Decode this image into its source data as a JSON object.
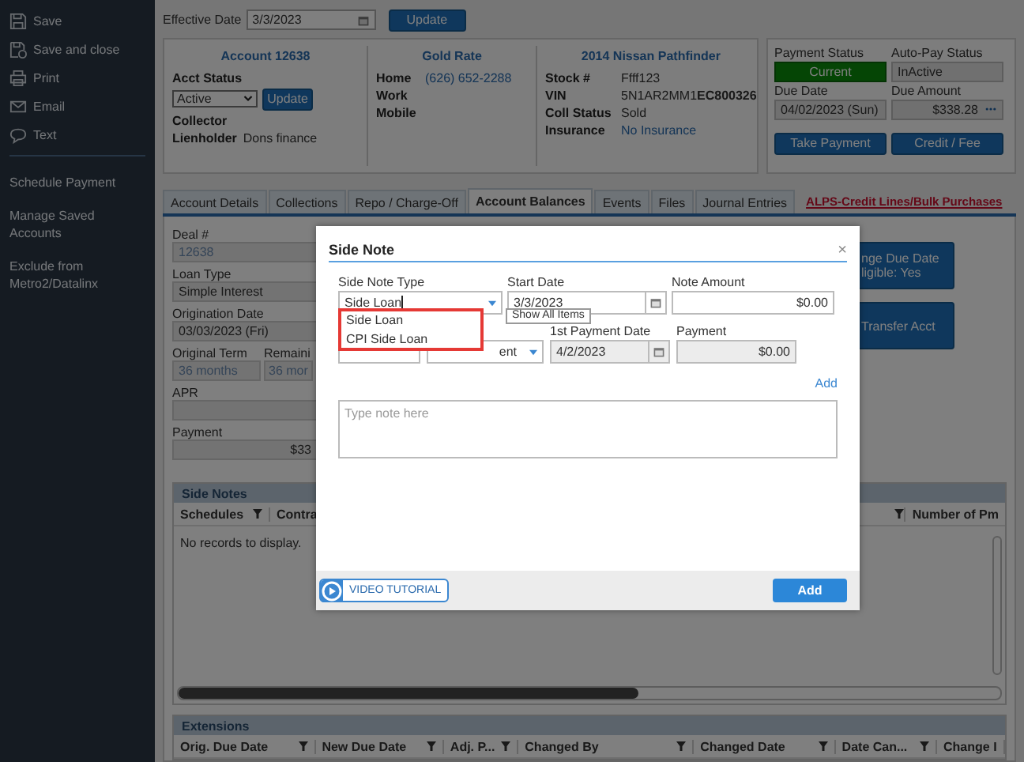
{
  "sidebar": {
    "actions": [
      {
        "label": "Save"
      },
      {
        "label": "Save and close"
      },
      {
        "label": "Print"
      },
      {
        "label": "Email"
      },
      {
        "label": "Text"
      }
    ],
    "links": [
      "Schedule Payment",
      "Manage Saved Accounts",
      "Exclude from Metro2/Datalinx"
    ]
  },
  "effective_date": {
    "label": "Effective Date",
    "value": "3/3/2023",
    "button": "Update"
  },
  "account": {
    "title": "Account 12638",
    "status_label": "Acct Status",
    "status_value": "Active",
    "update_button": "Update",
    "fields": [
      {
        "label": "Collector"
      },
      {
        "label": "Lienholder",
        "value": "Dons finance"
      }
    ]
  },
  "rate": {
    "title": "Gold Rate",
    "phones": [
      {
        "label": "Home",
        "value": "(626) 652-2288"
      },
      {
        "label": "Work"
      },
      {
        "label": "Mobile"
      }
    ]
  },
  "vehicle": {
    "title": "2014 Nissan Pathfinder",
    "fields": [
      {
        "label": "Stock #",
        "value": "Ffff123",
        "kind": "text"
      },
      {
        "label": "VIN",
        "value": "5N1AR2MM1**EC800326**",
        "kind": "text"
      },
      {
        "label": "Coll Status",
        "value": "Sold",
        "kind": "text"
      },
      {
        "label": "Insurance",
        "value": "No Insurance",
        "kind": "link"
      }
    ]
  },
  "payment": {
    "status_label": "Payment Status",
    "status": "Current",
    "autopay_label": "Auto-Pay Status",
    "autopay": "InActive",
    "due_date_label": "Due Date",
    "due_date": "04/02/2023 (Sun)",
    "due_amount_label": "Due Amount",
    "due_amount": "$338.28",
    "buttons": [
      "Take Payment",
      "Credit / Fee"
    ]
  },
  "tabs": [
    {
      "label": "Account Details",
      "selected": false
    },
    {
      "label": "Collections",
      "selected": false
    },
    {
      "label": "Repo / Charge-Off",
      "selected": false
    },
    {
      "label": "Account Balances",
      "selected": true
    },
    {
      "label": "Events",
      "selected": false
    },
    {
      "label": "Files",
      "selected": false
    },
    {
      "label": "Journal Entries",
      "selected": false
    }
  ],
  "tab_link": "ALPS-Credit Lines/Bulk Purchases",
  "balances": {
    "fields": [
      {
        "label": "Deal #",
        "value": "12638"
      },
      {
        "label": "Loan Type",
        "value": "Simple Interest"
      },
      {
        "label": "Origination Date",
        "value": "03/03/2023 (Fri)"
      }
    ],
    "term": {
      "label": "Original Term",
      "value": "36 months",
      "remaining_label": "Remaini",
      "remaining_value": "36 mor"
    },
    "apr_label": "APR",
    "payment_label": "Payment",
    "payment_value": "$33",
    "buttons": [
      "nge Due Date\nligible: Yes",
      "Transfer Acct"
    ]
  },
  "side_notes": {
    "title": "Side Notes",
    "columns_left": [
      "Schedules",
      "Contra"
    ],
    "columns_right": [
      "Number of Pm"
    ],
    "empty": "No records to display."
  },
  "extensions": {
    "title": "Extensions",
    "columns": [
      "Orig. Due Date",
      "New Due Date",
      "Adj. P...",
      "Changed By",
      "Changed Date",
      "Date Can...",
      "Change I"
    ]
  },
  "modal": {
    "title": "Side Note",
    "close": "×",
    "type_label": "Side Note Type",
    "type_value": "Side Loan",
    "start_label": "Start Date",
    "start_value": "3/3/2023",
    "amount_label": "Note Amount",
    "amount_value": "$0.00",
    "options": [
      "Side Loan",
      "CPI Side Loan"
    ],
    "tooltip": "Show All Items",
    "select_value": "ent",
    "first_payment_label": "1st Payment Date",
    "first_payment_value": "4/2/2023",
    "payment_label": "Payment",
    "payment_value": "$0.00",
    "add_link": "Add",
    "note_placeholder": "Type note here",
    "video_button": "VIDEO TUTORIAL",
    "add_button": "Add"
  }
}
